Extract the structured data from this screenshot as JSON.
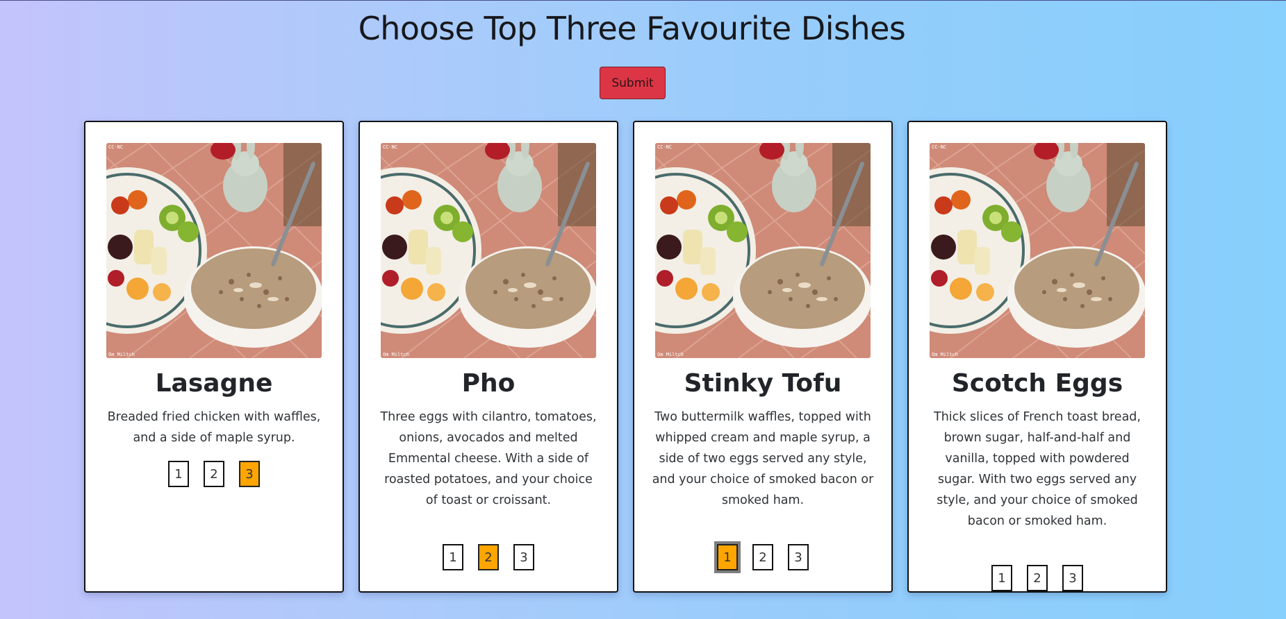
{
  "page": {
    "title": "Choose Top Three Favourite Dishes",
    "submit_label": "Submit"
  },
  "image": {
    "watermark_top": "CC-NC",
    "watermark_bottom": "Om Miltch"
  },
  "colors": {
    "selected_rank": "#ffa500",
    "submit_button": "#dc3545",
    "card_background": "#ffffff"
  },
  "cards": [
    {
      "name": "Lasagne",
      "description": "Breaded fried chicken with waffles, and a side of maple syrup.",
      "ranks": [
        "1",
        "2",
        "3"
      ],
      "selected_rank": "3"
    },
    {
      "name": "Pho",
      "description": "Three eggs with cilantro, tomatoes, onions, avocados and melted Emmental cheese. With a side of roasted potatoes, and your choice of toast or croissant.",
      "ranks": [
        "1",
        "2",
        "3"
      ],
      "selected_rank": "2"
    },
    {
      "name": "Stinky Tofu",
      "description": "Two buttermilk waffles, topped with whipped cream and maple syrup, a side of two eggs served any style, and your choice of smoked bacon or smoked ham.",
      "ranks": [
        "1",
        "2",
        "3"
      ],
      "selected_rank": "1"
    },
    {
      "name": "Scotch Eggs",
      "description": "Thick slices of French toast bread, brown sugar, half-and-half and vanilla, topped with powdered sugar. With two eggs served any style, and your choice of smoked bacon or smoked ham.",
      "ranks": [
        "1",
        "2",
        "3"
      ],
      "selected_rank": ""
    }
  ]
}
